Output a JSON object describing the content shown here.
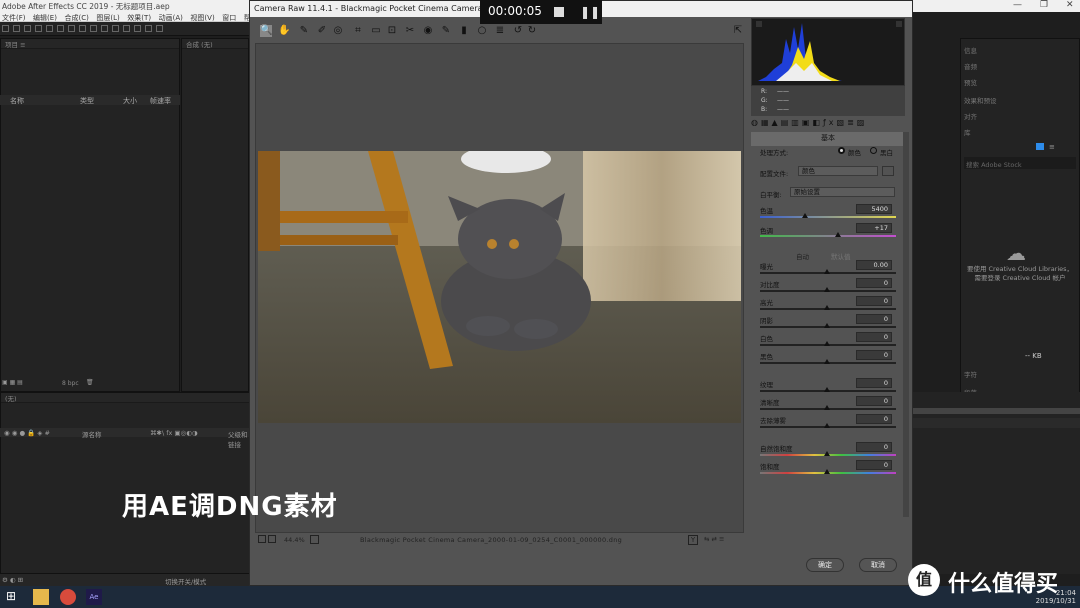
{
  "ae": {
    "title": "Adobe After Effects CC 2019 - 无标题项目.aep",
    "menu": [
      "文件(F)",
      "编辑(E)",
      "合成(C)",
      "图层(L)",
      "效果(T)",
      "动画(A)",
      "视图(V)",
      "窗口",
      "帮助"
    ],
    "project_tab": "项目 ≡",
    "comp_tab": "合成 (无)",
    "project_columns": {
      "name": "名称",
      "type": "类型",
      "size": "大小",
      "fps": "帧速率"
    },
    "bpc": "8 bpc",
    "timeline_tab": "(无)",
    "timeline_columns": {
      "source": "源名称",
      "parent": "父级和链接"
    },
    "timeline_footer": "切换开关/模式",
    "right_panel": {
      "items": [
        "信息",
        "音频",
        "预览",
        "效果和预设",
        "对齐",
        "库"
      ],
      "search": "搜索 Adobe Stock",
      "cloud_text_1": "要使用 Creative Cloud Libraries，",
      "cloud_text_2": "需要登录 Creative Cloud 帐户",
      "kb": "-- KB",
      "bottom_items": [
        "字符",
        "段落"
      ]
    }
  },
  "taskbar": {
    "time": "21:04",
    "date": "2019/10/31"
  },
  "camera_raw": {
    "title": "Camera Raw 11.4.1  -  Blackmagic Pocket Cinema Camera",
    "zoom": "44.4%",
    "filename": "Blackmagic Pocket Cinema Camera_2000-01-09_0254_C0001_000000.dng",
    "rgb": {
      "r": "R:",
      "g": "G:",
      "b": "B:",
      "dash": "——"
    },
    "basic_header": "基本",
    "treatment_label": "处理方式:",
    "treatment_color": "颜色",
    "treatment_bw": "黑白",
    "profile_label": "配置文件:",
    "profile_value": "颜色",
    "wb_label": "白平衡:",
    "wb_value": "原始设置",
    "temp_label": "色温",
    "temp_value": "5400",
    "tint_label": "色调",
    "tint_value": "+17",
    "auto": "自动",
    "default": "默认值",
    "exposure_label": "曝光",
    "exposure_value": "0.00",
    "contrast_label": "对比度",
    "contrast_value": "0",
    "highlights_label": "高光",
    "highlights_value": "0",
    "shadows_label": "阴影",
    "shadows_value": "0",
    "whites_label": "白色",
    "whites_value": "0",
    "blacks_label": "黑色",
    "blacks_value": "0",
    "texture_label": "纹理",
    "texture_value": "0",
    "clarity_label": "清晰度",
    "clarity_value": "0",
    "dehaze_label": "去除薄雾",
    "dehaze_value": "0",
    "vibrance_label": "自然饱和度",
    "vibrance_value": "0",
    "saturation_label": "饱和度",
    "saturation_value": "0",
    "ok": "确定",
    "cancel": "取消"
  },
  "recorder": {
    "time": "00:00:05"
  },
  "subtitle": "用AE调DNG素材",
  "watermark": "什么值得买",
  "colors": {
    "accent": "#2d8ceb",
    "dialog_bg": "#535353",
    "ae_bg": "#232323"
  }
}
